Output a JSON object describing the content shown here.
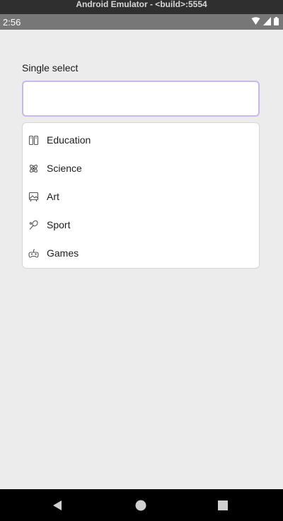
{
  "emulator": {
    "title": "Android Emulator - <build>:5554"
  },
  "status_bar": {
    "time": "2:56"
  },
  "form": {
    "label": "Single select",
    "input_value": ""
  },
  "dropdown": {
    "options": [
      {
        "label": "Education",
        "icon": "book-icon"
      },
      {
        "label": "Science",
        "icon": "atom-icon"
      },
      {
        "label": "Art",
        "icon": "picture-icon"
      },
      {
        "label": "Sport",
        "icon": "racket-icon"
      },
      {
        "label": "Games",
        "icon": "gamepad-icon"
      }
    ]
  },
  "colors": {
    "accent_border": "#c9b8ec",
    "background": "#ececec"
  }
}
